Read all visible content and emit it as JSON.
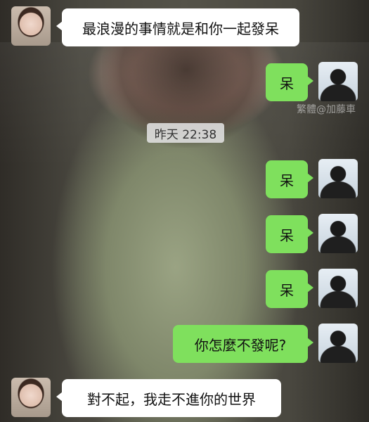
{
  "chat": {
    "timestamp": "昨天 22:38",
    "watermark": "繁體@加藤車",
    "messages": [
      {
        "side": "left",
        "text": "最浪漫的事情就是和你一起發呆"
      },
      {
        "side": "right",
        "text": "呆"
      },
      {
        "side": "right",
        "text": "呆"
      },
      {
        "side": "right",
        "text": "呆"
      },
      {
        "side": "right",
        "text": "呆"
      },
      {
        "side": "right",
        "text": "你怎麼不發呢?"
      },
      {
        "side": "left",
        "text": "對不起，我走不進你的世界"
      }
    ]
  },
  "colors": {
    "incoming_bubble": "#ffffff",
    "outgoing_bubble": "#7fe05d"
  },
  "icons": {
    "incoming_avatar": "girl-avatar-icon",
    "outgoing_avatar": "boy-avatar-icon"
  }
}
